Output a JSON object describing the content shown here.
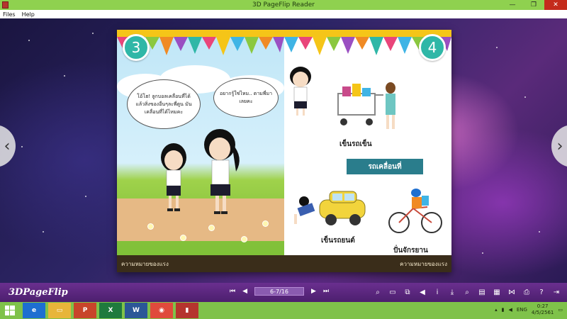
{
  "window": {
    "title": "3D PageFlip Reader",
    "min_glyph": "—",
    "restore_glyph": "❐",
    "close_glyph": "✕"
  },
  "menu": {
    "items": [
      {
        "label": "Files"
      },
      {
        "label": "Help"
      }
    ]
  },
  "book": {
    "left_page": {
      "number": "3",
      "bubble_left": "โอ้โฮ! ลูกบอลเคลื่อนที่ได้ แล้วสิ่งของอื่นๆละพี่ตูน มันเคลื่อนที่ได้ไหมคะ",
      "bubble_right": "อยากรู้ใช่ไหม.. ตามพี่มาเลยคะ",
      "footer": "ความหมายของแรง"
    },
    "right_page": {
      "number": "4",
      "cart_caption": "เข็นรถเข็น",
      "ribbon": "รถเคลื่อนที่",
      "car_caption": "เข็นรถยนต์",
      "bike_caption": "ปั่นจักรยาน",
      "footer": "ความหมายของแรง"
    }
  },
  "toolbar": {
    "logo": "3DPageFlip",
    "first_glyph": "⏮",
    "prev_glyph": "◀",
    "page_indicator": "6-7/16",
    "next_glyph": "▶",
    "last_glyph": "⏭",
    "tools": [
      {
        "name": "zoom-icon",
        "glyph": "⌕"
      },
      {
        "name": "single-page-icon",
        "glyph": "▭"
      },
      {
        "name": "fullscreen-icon",
        "glyph": "⧉"
      },
      {
        "name": "sound-icon",
        "glyph": "◀"
      },
      {
        "name": "info-icon",
        "glyph": "i"
      },
      {
        "name": "download-icon",
        "glyph": "⤓"
      },
      {
        "name": "search-icon",
        "glyph": "⌕"
      },
      {
        "name": "bookmark-icon",
        "glyph": "▤"
      },
      {
        "name": "thumbnails-icon",
        "glyph": "▦"
      },
      {
        "name": "share-icon",
        "glyph": "⋈"
      },
      {
        "name": "print-icon",
        "glyph": "⎙"
      },
      {
        "name": "help-icon",
        "glyph": "?"
      },
      {
        "name": "exit-icon",
        "glyph": "⇥"
      }
    ]
  },
  "taskbar": {
    "apps": [
      {
        "name": "ie-taskbar-button",
        "glyph": "e",
        "color": "#1d6fd1"
      },
      {
        "name": "explorer-taskbar-button",
        "glyph": "▭",
        "color": "#e7b53a"
      },
      {
        "name": "powerpoint-taskbar-button",
        "glyph": "P",
        "color": "#c8452a"
      },
      {
        "name": "excel-taskbar-button",
        "glyph": "X",
        "color": "#1f7a3d"
      },
      {
        "name": "word-taskbar-button",
        "glyph": "W",
        "color": "#2b5797"
      },
      {
        "name": "chrome-taskbar-button",
        "glyph": "◉",
        "color": "#e04a3c"
      },
      {
        "name": "pageflip-taskbar-button",
        "glyph": "▮",
        "color": "#b5352e"
      }
    ],
    "language": "ENG",
    "time": "0:27",
    "date": "4/5/2561"
  },
  "colors": {
    "titlebar": "#8fd14f",
    "toolbar": "#5a2780",
    "taskbar": "#7fc24a",
    "page_badge": "#2fb7a7"
  }
}
